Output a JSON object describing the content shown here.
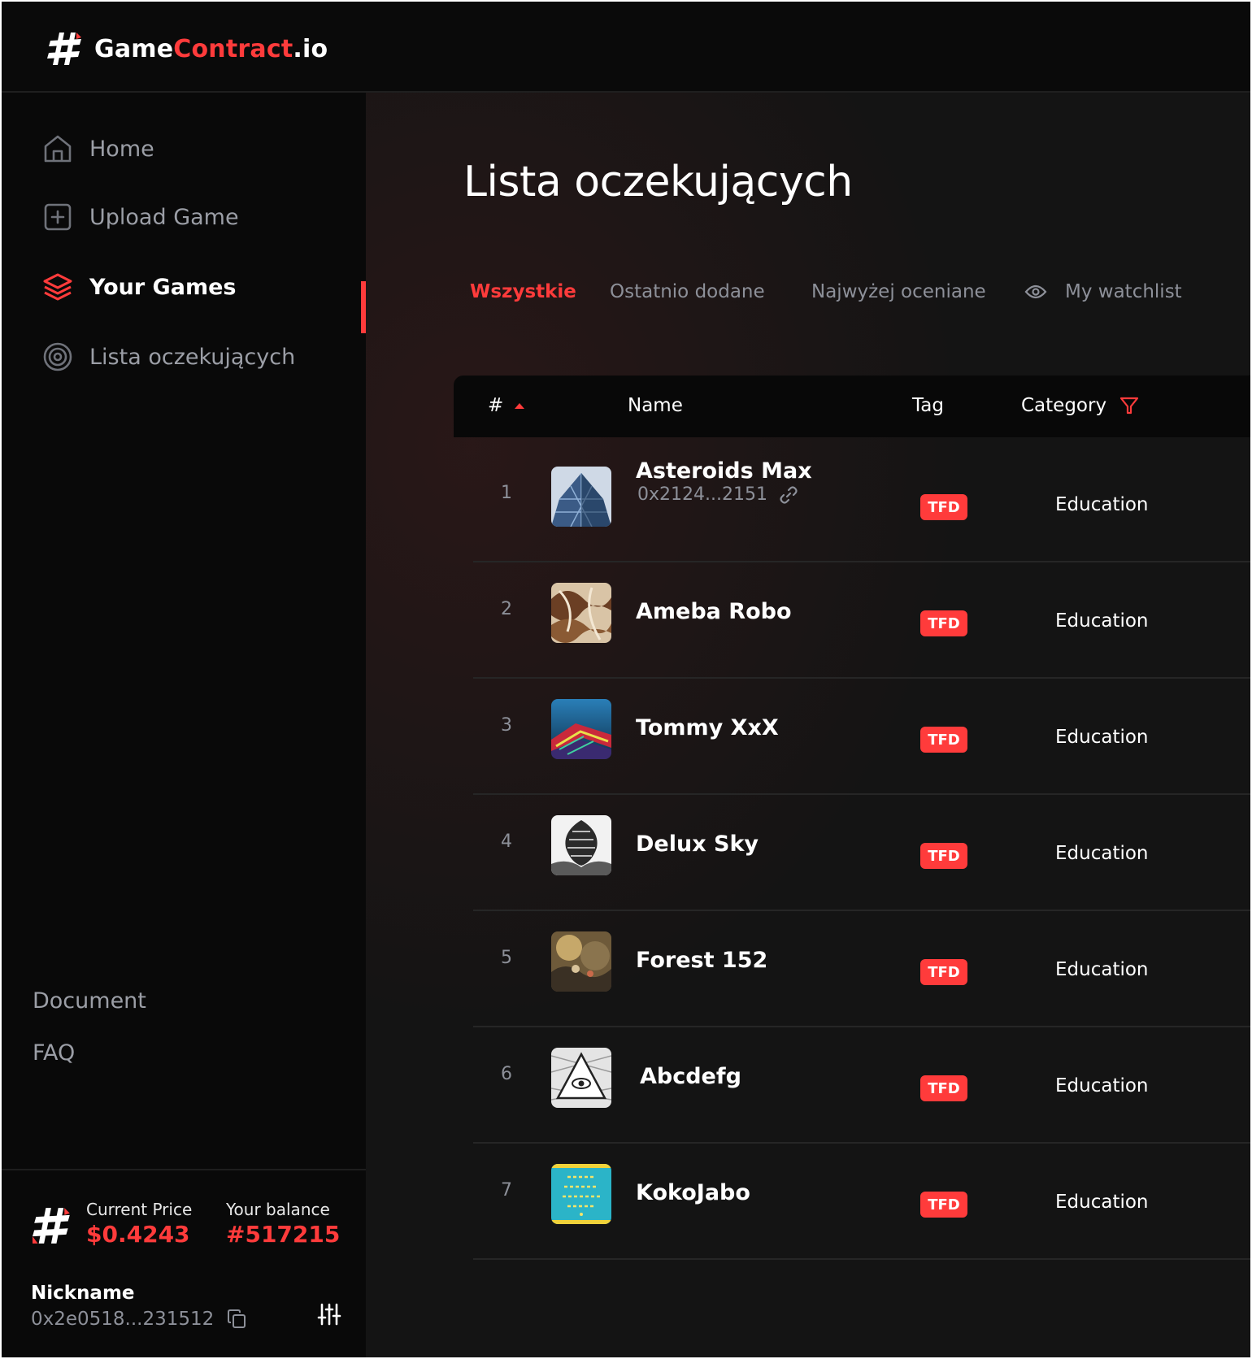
{
  "brand": {
    "name_part1": "Game",
    "name_part2": "Contract",
    "name_part3": ".io"
  },
  "sidebar": {
    "items": [
      {
        "label": "Home",
        "icon": "home-icon"
      },
      {
        "label": "Upload Game",
        "icon": "plus-square-icon"
      },
      {
        "label": "Your Games",
        "icon": "layers-icon",
        "active": true
      },
      {
        "label": "Lista oczekujących",
        "icon": "target-icon"
      }
    ],
    "footer_links": [
      "Document",
      "FAQ"
    ]
  },
  "wallet": {
    "current_price_label": "Current Price",
    "current_price_value": "$0.4243",
    "balance_label": "Your balance",
    "balance_value": "#517215",
    "nickname": "Nickname",
    "address": "0x2e0518...231512"
  },
  "page": {
    "title": "Lista oczekujących",
    "tabs": [
      "Wszystkie",
      "Ostatnio dodane",
      "Najwyżej oceniane",
      "My watchlist"
    ],
    "active_tab": "Wszystkie"
  },
  "table": {
    "columns": [
      "#",
      "Name",
      "Tag",
      "Category"
    ],
    "rows": [
      {
        "num": "1",
        "name": "Asteroids Max",
        "address": "0x2124...2151",
        "tag": "TFD",
        "category": "Education"
      },
      {
        "num": "2",
        "name": "Ameba Robo",
        "tag": "TFD",
        "category": "Education"
      },
      {
        "num": "3",
        "name": "Tommy XxX",
        "tag": "TFD",
        "category": "Education"
      },
      {
        "num": "4",
        "name": "Delux Sky",
        "tag": "TFD",
        "category": "Education"
      },
      {
        "num": "5",
        "name": "Forest 152",
        "tag": "TFD",
        "category": "Education"
      },
      {
        "num": "6",
        "name": "Abcdefg",
        "tag": "TFD",
        "category": "Education"
      },
      {
        "num": "7",
        "name": "KokoJabo",
        "tag": "TFD",
        "category": "Education"
      }
    ]
  },
  "colors": {
    "accent": "#ff3b3b",
    "bg": "#121212",
    "sidebar": "#090909",
    "muted_text": "#8d9099"
  }
}
